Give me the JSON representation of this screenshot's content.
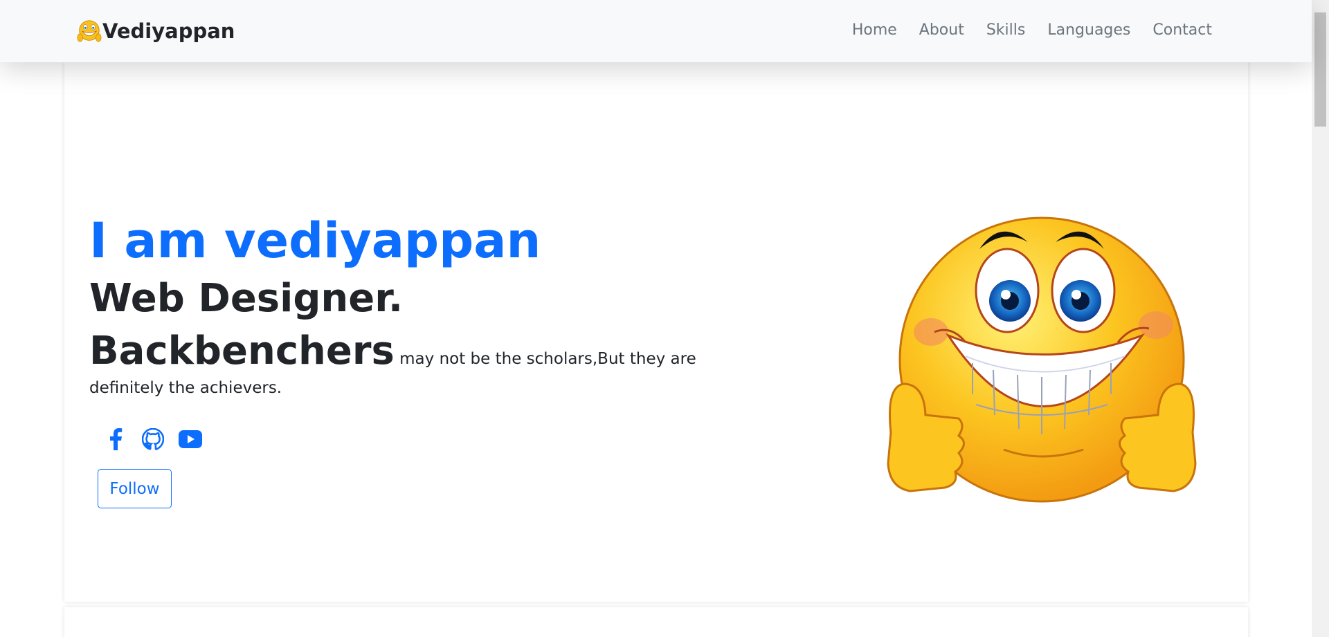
{
  "navbar": {
    "brand": "Vediyappan",
    "links": [
      {
        "label": "Home"
      },
      {
        "label": "About"
      },
      {
        "label": "Skills"
      },
      {
        "label": "Languages"
      },
      {
        "label": "Contact"
      }
    ]
  },
  "hero": {
    "name": "I am vediyappan",
    "role": "Web Designer.",
    "quote_big": "Backbenchers",
    "quote_rest": " may not be the scholars,But they are definitely the achievers.",
    "socials": [
      {
        "icon": "facebook-icon"
      },
      {
        "icon": "github-icon"
      },
      {
        "icon": "youtube-icon"
      }
    ],
    "follow_label": "Follow"
  },
  "colors": {
    "accent": "#0d6efd",
    "text": "#212529",
    "nav_text": "#6c757d",
    "navbar_bg": "#f8f9fa"
  }
}
